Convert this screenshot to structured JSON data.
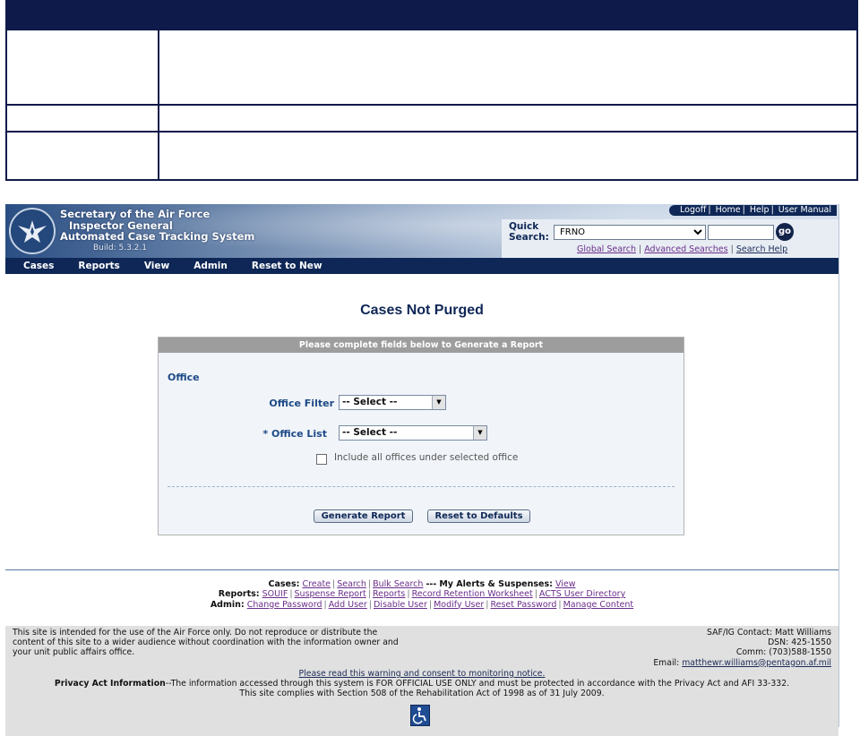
{
  "app": {
    "title_line1": "Secretary of the Air Force",
    "title_line2": "Inspector General",
    "title_line3": "Automated Case Tracking System",
    "build": "Build: 5.3.2.1"
  },
  "utility_links": [
    "Logoff",
    "Home",
    "Help",
    "User Manual"
  ],
  "quick_search": {
    "label_line1": "Quick",
    "label_line2": "Search:",
    "selected": "FRNO",
    "go_label": "go",
    "links": [
      "Global Search",
      "Advanced Searches",
      "Search Help"
    ]
  },
  "nav": [
    "Cases",
    "Reports",
    "View",
    "Admin",
    "Reset to New"
  ],
  "page": {
    "title": "Cases Not Purged",
    "form_header": "Please complete fields below to Generate a Report",
    "section_label": "Office",
    "office_filter_label": "Office Filter",
    "office_filter_value": "-- Select --",
    "office_list_label": "* Office List",
    "office_list_value": "-- Select --",
    "include_all_label": "Include all offices under selected office",
    "generate_button": "Generate Report",
    "reset_button": "Reset to Defaults"
  },
  "footer": {
    "cases_label": "Cases:",
    "cases_links": [
      "Create",
      "Search",
      "Bulk Search"
    ],
    "alerts_sep": "---",
    "alerts_label": "My Alerts & Suspenses:",
    "alerts_link": "View",
    "reports_label": "Reports:",
    "reports_links": [
      "SOUIF",
      "Suspense Report",
      "Reports",
      "Record Retention Worksheet",
      "ACTS User Directory"
    ],
    "admin_label": "Admin:",
    "admin_links": [
      "Change Password",
      "Add User",
      "Disable User",
      "Modify User",
      "Reset Password",
      "Manage Content"
    ]
  },
  "bottom": {
    "disclaimer": "This site is intended for the use of the Air Force only. Do not reproduce or distribute the content of this site to a wider audience without coordination with the information owner and your unit public affairs office.",
    "contact_line1": "SAF/IG Contact: Matt Williams",
    "contact_line2": "DSN: 425-1550",
    "contact_line3": "Comm: (703)588-1550",
    "email_label": "Email:",
    "email": "matthewr.williams@pentagon.af.mil",
    "warning_link": "Please read this warning and consent to monitoring notice.",
    "privacy_label": "Privacy Act Information",
    "privacy_text": "--The information accessed through this system is FOR OFFICIAL USE ONLY and must be protected in accordance with the Privacy Act and AFI 33-332.",
    "section508": "This site complies with Section 508 of the Rehabilitation Act of 1998 as of 31 July 2009."
  }
}
